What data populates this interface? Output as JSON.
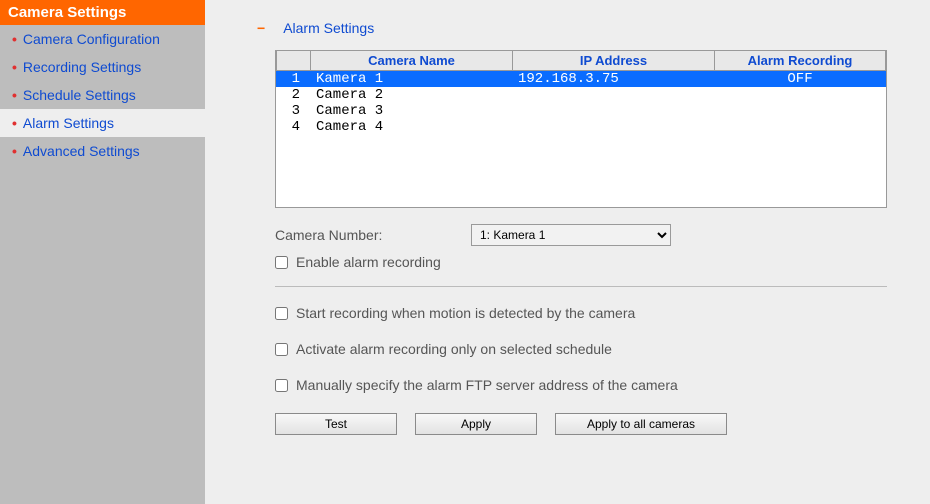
{
  "sidebar": {
    "header": "Camera Settings",
    "items": [
      {
        "label": "Camera Configuration"
      },
      {
        "label": "Recording Settings"
      },
      {
        "label": "Schedule Settings"
      },
      {
        "label": "Alarm Settings"
      },
      {
        "label": "Advanced Settings"
      }
    ]
  },
  "main": {
    "section_title": "Alarm Settings",
    "table": {
      "headers": {
        "name": "Camera Name",
        "ip": "IP Address",
        "alarm": "Alarm Recording"
      },
      "rows": [
        {
          "num": "1",
          "name": "Kamera 1",
          "ip": "192.168.3.75",
          "alarm": "OFF",
          "selected": true
        },
        {
          "num": "2",
          "name": "Camera 2",
          "ip": "",
          "alarm": "",
          "selected": false
        },
        {
          "num": "3",
          "name": "Camera 3",
          "ip": "",
          "alarm": "",
          "selected": false
        },
        {
          "num": "4",
          "name": "Camera 4",
          "ip": "",
          "alarm": "",
          "selected": false
        }
      ]
    },
    "camera_number_label": "Camera Number:",
    "camera_number_value": "1: Kamera 1",
    "enable_alarm_label": "Enable alarm recording",
    "start_recording_label": "Start recording when motion is detected by the camera",
    "activate_schedule_label": "Activate alarm recording only on selected schedule",
    "manual_ftp_label": "Manually specify the alarm FTP server address of the camera",
    "buttons": {
      "test": "Test",
      "apply": "Apply",
      "apply_all": "Apply to all cameras"
    }
  }
}
